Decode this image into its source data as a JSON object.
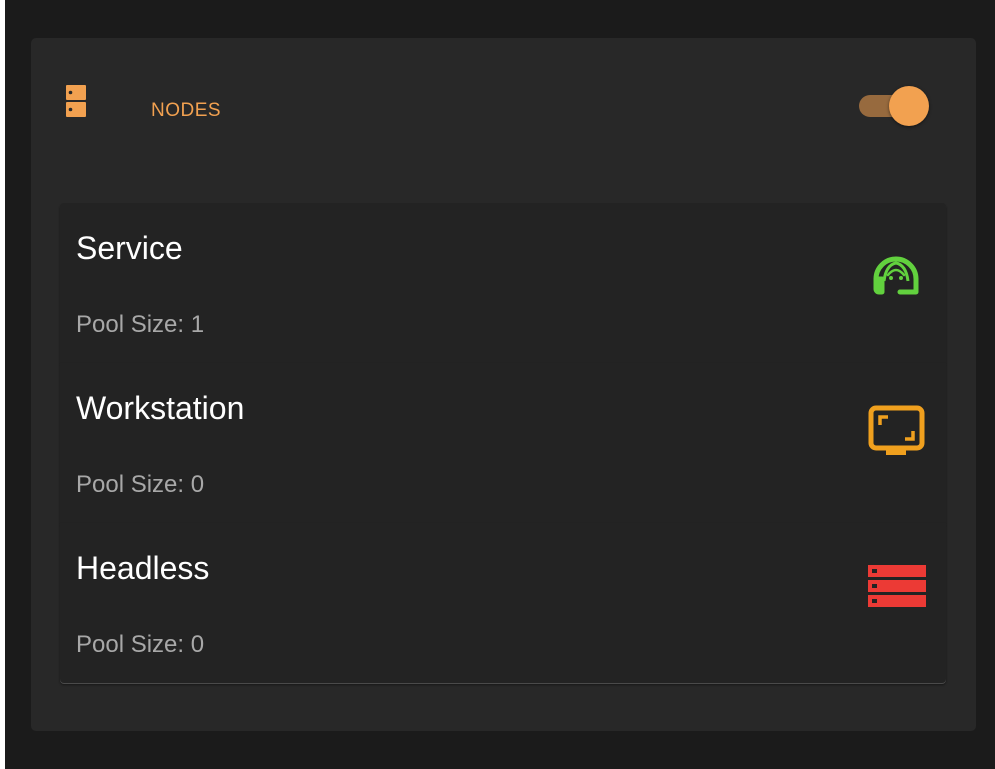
{
  "colors": {
    "accent": "#f2a150",
    "service": "#62d13e",
    "workstation": "#f0a01e",
    "headless": "#ec3a35"
  },
  "panel": {
    "icon": "server-icon",
    "title": "NODES",
    "toggle": {
      "on": true
    }
  },
  "nodes": [
    {
      "name": "Service",
      "pool_size": "Pool Size: 1",
      "icon": "headset-support-icon"
    },
    {
      "name": "Workstation",
      "pool_size": "Pool Size: 0",
      "icon": "monitor-icon"
    },
    {
      "name": "Headless",
      "pool_size": "Pool Size: 0",
      "icon": "server-rack-icon"
    }
  ]
}
